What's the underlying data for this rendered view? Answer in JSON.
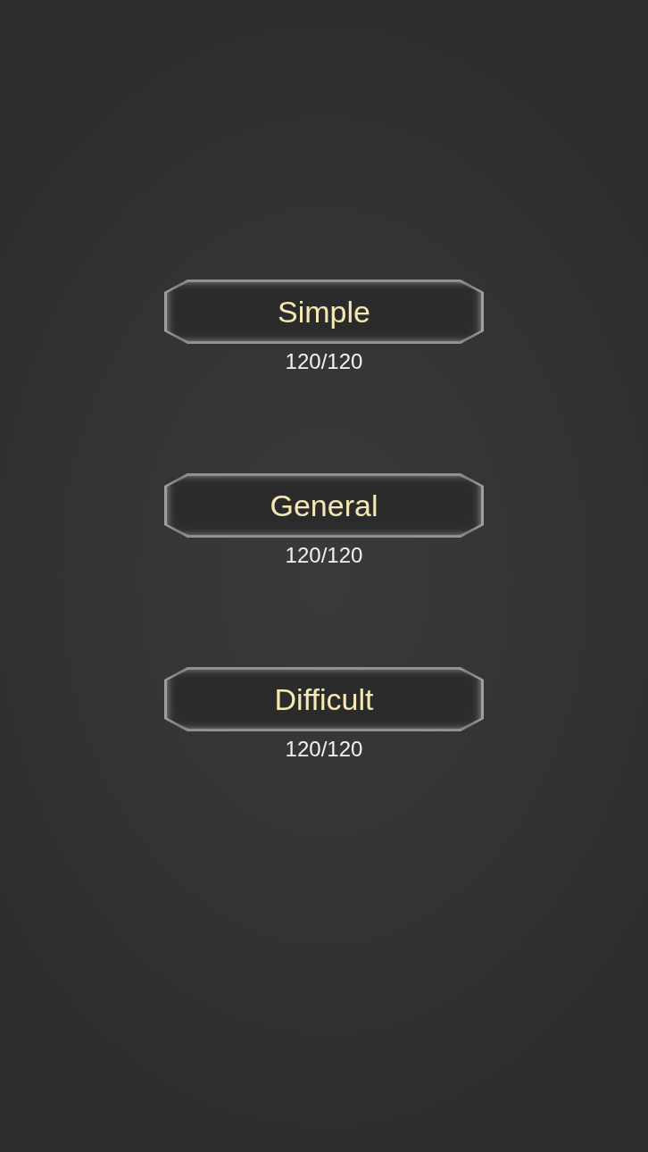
{
  "levels": [
    {
      "label": "Simple",
      "score": "120/120"
    },
    {
      "label": "General",
      "score": "120/120"
    },
    {
      "label": "Difficult",
      "score": "120/120"
    }
  ]
}
